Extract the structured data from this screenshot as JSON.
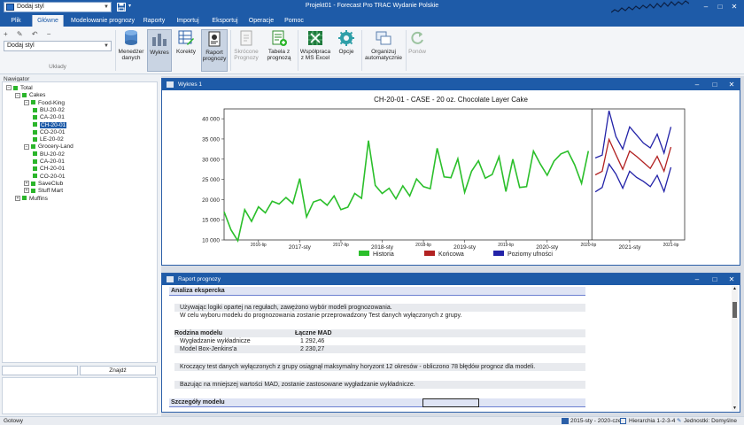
{
  "window": {
    "title": "Projekt01 - Forecast Pro TRAC Wydanie Polskie",
    "quick_access_combo": "Dodaj styl",
    "controls": [
      "‒",
      "□",
      "✕"
    ]
  },
  "menu_tabs": [
    "Plik",
    "Główne",
    "Modelowanie prognozy",
    "Raporty",
    "Importuj",
    "Eksportuj",
    "Operacje",
    "Pomoc"
  ],
  "menu_active": "Główne",
  "ribbon": {
    "mini_icons": "+ ✎ ↶ −",
    "style_combo": "Dodaj styl",
    "group_label": "Układy",
    "buttons": [
      {
        "label": "Menedżer danych"
      },
      {
        "label": "Wykres"
      },
      {
        "label": "Korekty"
      },
      {
        "label": "Raport prognozy"
      },
      {
        "label": "Skrócone Prognozy"
      },
      {
        "label": "Tabela z prognozą"
      },
      {
        "label": "Współpraca z MS Excel"
      },
      {
        "label": "Opcje"
      },
      {
        "label": "Organizuj automatycznie"
      },
      {
        "label": "Ponów"
      }
    ]
  },
  "navigator": {
    "title": "Nawigator",
    "tree": [
      {
        "label": "Total",
        "level": 0,
        "exp": "−"
      },
      {
        "label": "Cakes",
        "level": 1,
        "exp": "−"
      },
      {
        "label": "Food-King",
        "level": 2,
        "exp": "−"
      },
      {
        "label": "BU-20-02",
        "level": 3
      },
      {
        "label": "CA-20-01",
        "level": 3
      },
      {
        "label": "CH-20-01",
        "level": 3,
        "selected": true
      },
      {
        "label": "CO-20-01",
        "level": 3
      },
      {
        "label": "LE-20-02",
        "level": 3
      },
      {
        "label": "Grocery-Land",
        "level": 2,
        "exp": "−"
      },
      {
        "label": "BU-20-02",
        "level": 3
      },
      {
        "label": "CA-20-01",
        "level": 3
      },
      {
        "label": "CH-20-01",
        "level": 3
      },
      {
        "label": "CO-20-01",
        "level": 3
      },
      {
        "label": "SaveClub",
        "level": 2,
        "exp": "+"
      },
      {
        "label": "Stuff Mart",
        "level": 2,
        "exp": "+"
      },
      {
        "label": "Muffins",
        "level": 1,
        "exp": "+"
      }
    ],
    "find_button": "Znajdź"
  },
  "chart_panel": {
    "title": "Wykres 1"
  },
  "chart_data": {
    "type": "line",
    "title": "CH-20-01 - CASE - 20 oz. Chocolate Layer Cake",
    "ylim": [
      10000,
      42000
    ],
    "yticks": [
      "10 000",
      "15 000",
      "20 000",
      "25 000",
      "30 000",
      "35 000",
      "40 000"
    ],
    "ytick_values": [
      10000,
      15000,
      20000,
      25000,
      30000,
      35000,
      40000
    ],
    "xticks": [
      {
        "label": "2016-lip",
        "i": 6,
        "minor": true
      },
      {
        "label": "2017-sty",
        "i": 12,
        "minor": false
      },
      {
        "label": "2017-lip",
        "i": 18,
        "minor": true
      },
      {
        "label": "2018-sty",
        "i": 24,
        "minor": false
      },
      {
        "label": "2018-lip",
        "i": 30,
        "minor": true
      },
      {
        "label": "2019-sty",
        "i": 36,
        "minor": false
      },
      {
        "label": "2019-lip",
        "i": 42,
        "minor": true
      },
      {
        "label": "2020-sty",
        "i": 48,
        "minor": false
      },
      {
        "label": "2020-lip",
        "i": 54,
        "minor": true
      },
      {
        "label": "2021-sty",
        "i": 60,
        "minor": false
      },
      {
        "label": "2021-lip",
        "i": 66,
        "minor": true
      }
    ],
    "x_start": 1,
    "x_end": 68,
    "forecast_divider": 54.5,
    "series": [
      {
        "name": "Historia",
        "color": "#2bbf2b",
        "start": 1,
        "values": [
          17000,
          12500,
          9800,
          17500,
          14600,
          18200,
          16700,
          19600,
          18900,
          20500,
          19000,
          25200,
          15700,
          19400,
          20000,
          18600,
          20900,
          17500,
          18100,
          21500,
          20300,
          34600,
          23500,
          21500,
          22800,
          20200,
          23400,
          20900,
          25100,
          23200,
          22700,
          32700,
          25600,
          25400,
          30100,
          21800,
          27000,
          29600,
          25300,
          26200,
          30600,
          22000,
          30000,
          23000,
          23200,
          32000,
          28800,
          26000,
          29500,
          31300,
          32000,
          28600,
          24000,
          32000
        ]
      },
      {
        "name": "Końcowa",
        "color": "#b22222",
        "start": 55,
        "values": [
          26100,
          27000,
          34900,
          31100,
          27500,
          32000,
          30700,
          29200,
          27700,
          30700,
          27000,
          33000
        ]
      },
      {
        "name": "Poziomy ufności",
        "color": "#2323a8",
        "start": 55,
        "band": true,
        "upper": [
          30300,
          31000,
          42000,
          35600,
          32500,
          38000,
          36000,
          34000,
          32800,
          36200,
          31500,
          38000
        ],
        "lower": [
          21900,
          23000,
          28800,
          26300,
          22800,
          27000,
          25500,
          24500,
          23200,
          26000,
          22000,
          28000
        ]
      }
    ],
    "legend": [
      "Historia",
      "Końcowa",
      "Poziomy ufności"
    ],
    "legend_position": "bottom"
  },
  "report_panel": {
    "title": "Raport prognozy"
  },
  "report": {
    "analysis_heading": "Analiza ekspercka",
    "line1": "Używając logiki opartej na regułach, zawężono wybór modeli prognozowania.",
    "line2": "W celu wyboru modelu do prognozowania zostanie przeprowadzony Test danych wyłączonych z grupy.",
    "family_header": "Rodzina modelu",
    "mad_header": "Łączne MAD",
    "rows": [
      {
        "name": "Wygładzanie wykładnicze",
        "mad": "1 292,46"
      },
      {
        "name": "Model Box-Jenkins'a",
        "mad": "2 230,27"
      }
    ],
    "line3": "Kroczący test danych wyłączonych z grupy osiągnął maksymalny horyzont 12 okresów - obliczono 78 błędów prognoz dla modeli.",
    "line4": "Bazując na mniejszej wartości MAD, zostanie zastosowane wygładzanie wykładnicze.",
    "details_heading": "Szczegóły modelu"
  },
  "statusbar": {
    "left": "Gotowy",
    "range": "2015-sty - 2020-cze",
    "hierarchy": "Hierarchia 1-2-3-4",
    "units": "Jednostki: Domyślne"
  }
}
